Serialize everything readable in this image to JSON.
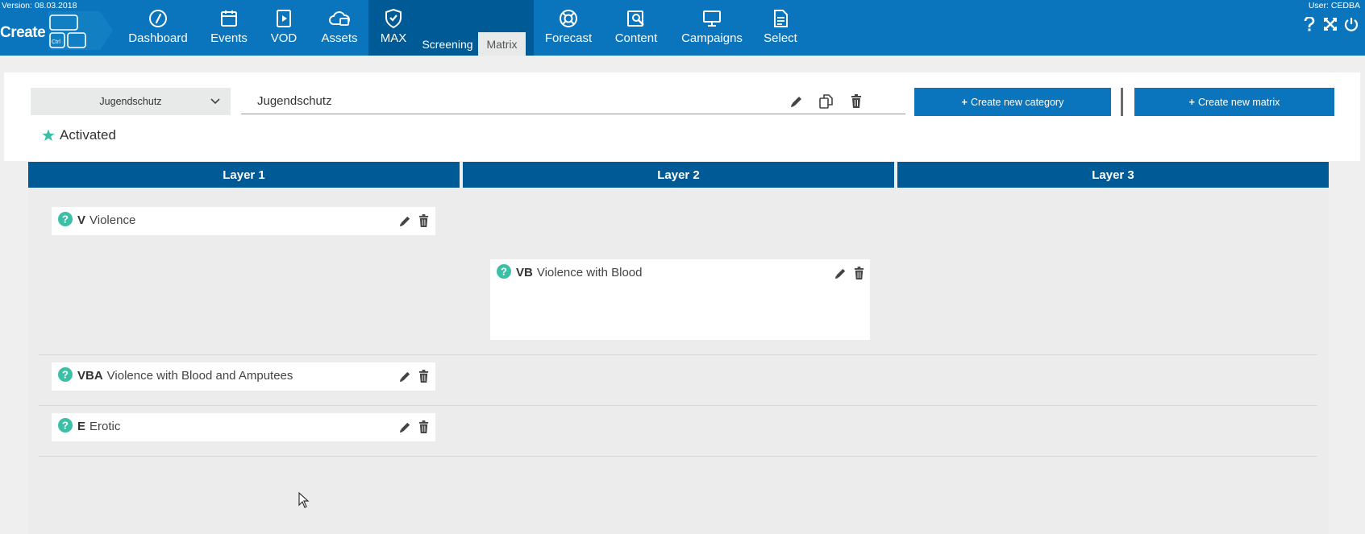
{
  "header": {
    "version": "Version: 08.03.2018",
    "user": "User: CEDBA",
    "logo_text": "Create",
    "logo_key": "Ctrl",
    "nav": [
      {
        "label": "Dashboard",
        "icon": "dashboard-gauge-icon"
      },
      {
        "label": "Events",
        "icon": "calendar-icon"
      },
      {
        "label": "VOD",
        "icon": "play-icon"
      },
      {
        "label": "Assets",
        "icon": "cloud-icon"
      },
      {
        "label": "MAX",
        "icon": "shield-check-icon"
      },
      {
        "label": "Forecast",
        "icon": "lifebuoy-icon"
      },
      {
        "label": "Content",
        "icon": "content-icon"
      },
      {
        "label": "Campaigns",
        "icon": "monitor-icon"
      },
      {
        "label": "Select",
        "icon": "document-icon"
      }
    ],
    "sub_tabs": [
      {
        "label": "Screening",
        "active": false
      },
      {
        "label": "Matrix",
        "active": true
      }
    ],
    "right_icons": [
      "help-icon",
      "fullscreen-icon",
      "power-icon"
    ]
  },
  "editor": {
    "selected_matrix": "Jugendschutz",
    "name_value": "Jugendschutz",
    "create_category_label": "Create new category",
    "create_matrix_label": "Create new matrix",
    "status": "Activated"
  },
  "layers": [
    {
      "label": "Layer 1"
    },
    {
      "label": "Layer 2"
    },
    {
      "label": "Layer 3"
    }
  ],
  "categories": [
    {
      "code": "V",
      "name": "Violence",
      "layer": 1
    },
    {
      "code": "VB",
      "name": "Violence with Blood",
      "layer": 2
    },
    {
      "code": "VBA",
      "name": "Violence with Blood and Amputees",
      "layer": 1
    },
    {
      "code": "E",
      "name": "Erotic",
      "layer": 1
    }
  ],
  "colors": {
    "topbar": "#0a75bd",
    "active_module": "#005a96",
    "layer_header": "#005a96",
    "accent": "#3cbfa6",
    "button": "#0a75bd"
  }
}
